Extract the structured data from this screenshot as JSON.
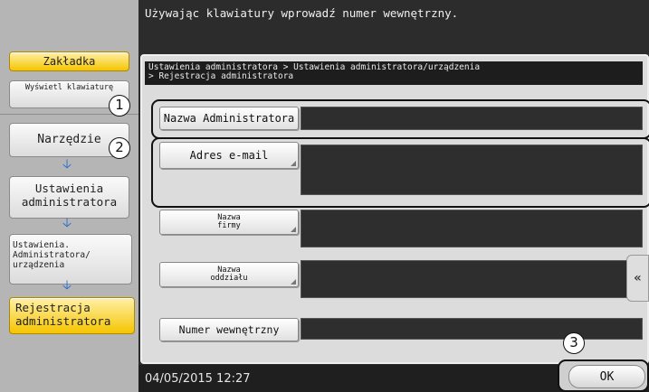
{
  "message": "Używając klawiatury wprowadź numer wewnętrzny.",
  "sidebar": {
    "tab_label": "Zakładka",
    "show_keyboard": "Wyświetl klawiaturę",
    "utility": "Narzędzie",
    "admin_settings": "Ustawienia administratora",
    "admin_device_settings": "Ustawienia. Administratora/ urządzenia",
    "admin_registration": "Rejestracja administratora",
    "arrow_icon": "arrow-down-icon"
  },
  "breadcrumb": {
    "line1": "Ustawienia administratora > Ustawienia administratora/urządzenia",
    "line2": "> Rejestracja administratora"
  },
  "form": {
    "admin_name_label": "Nazwa Administratora",
    "admin_name_value": "",
    "email_label": "Adres e-mail",
    "email_value": "",
    "company_label": "Nazwa firmy",
    "company_value": "",
    "department_label": "Nazwa oddziału",
    "department_value": "",
    "extension_label": "Numer wewnętrzny",
    "extension_value": ""
  },
  "callouts": {
    "one": "1",
    "two": "2",
    "three": "3"
  },
  "footer": {
    "datetime": "04/05/2015  12:27",
    "ok_label": "OK"
  },
  "side_tab_icon": "double-chevron-left-icon",
  "colors": {
    "active_yellow": "#f5c500",
    "arrow_blue": "#1e66d8",
    "panel_dark": "#2c2c2c"
  }
}
